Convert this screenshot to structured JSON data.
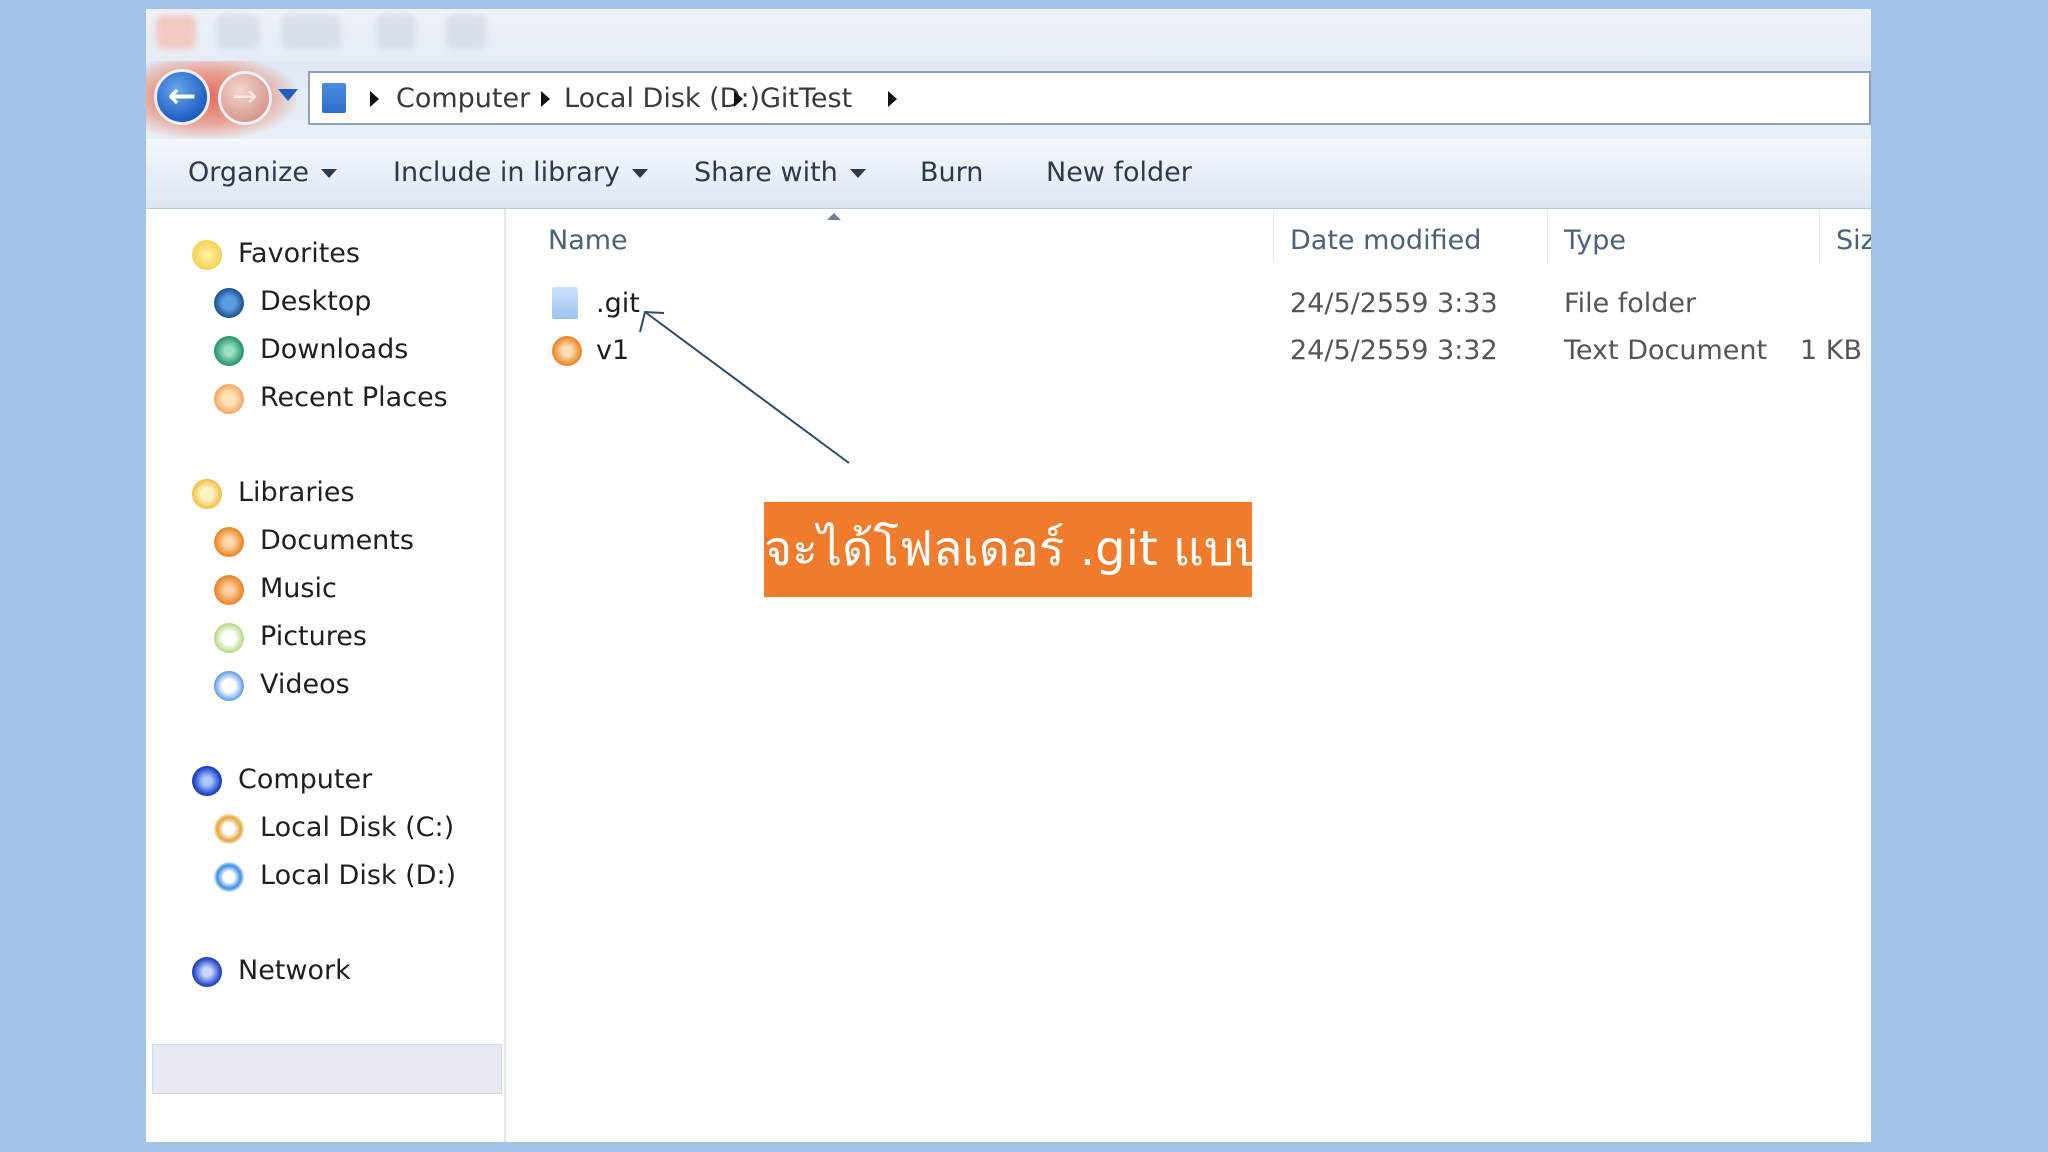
{
  "address": {
    "crumbs": [
      "Computer",
      "Local Disk (D:)",
      "GitTest"
    ]
  },
  "toolbar": {
    "organize": "Organize",
    "include_in_library": "Include in library",
    "share_with": "Share with",
    "burn": "Burn",
    "new_folder": "New folder"
  },
  "sidebar": {
    "favorites": {
      "label": "Favorites",
      "icon": "star-icon"
    },
    "favorite_items": [
      {
        "label": "Desktop",
        "icon": "desktop-icon"
      },
      {
        "label": "Downloads",
        "icon": "downloads-icon"
      },
      {
        "label": "Recent Places",
        "icon": "recent-places-icon"
      }
    ],
    "libraries": {
      "label": "Libraries",
      "icon": "library-icon"
    },
    "library_items": [
      {
        "label": "Documents",
        "icon": "documents-icon"
      },
      {
        "label": "Music",
        "icon": "music-icon"
      },
      {
        "label": "Pictures",
        "icon": "pictures-icon"
      },
      {
        "label": "Videos",
        "icon": "videos-icon"
      }
    ],
    "computer": {
      "label": "Computer",
      "icon": "computer-icon"
    },
    "computer_items": [
      {
        "label": "Local Disk (C:)",
        "icon": "drive-icon"
      },
      {
        "label": "Local Disk (D:)",
        "icon": "drive-icon",
        "selected": true
      }
    ],
    "network": {
      "label": "Network",
      "icon": "network-icon"
    }
  },
  "columns": {
    "name": "Name",
    "date_modified": "Date modified",
    "type": "Type",
    "size": "Size"
  },
  "files": [
    {
      "name": ".git",
      "date": "24/5/2559 3:33",
      "type": "File folder",
      "size": "",
      "icon": "folder-icon"
    },
    {
      "name": "v1",
      "date": "24/5/2559 3:32",
      "type": "Text Document",
      "size": "1 KB",
      "icon": "text-document-icon"
    }
  ],
  "annotation": {
    "text": "จะได้โฟลเดอร์ .git แบบนี้"
  },
  "colors": {
    "background": "#a3c2e8",
    "annotation": "#f07b2c",
    "arrow": "#2d4a6d"
  }
}
